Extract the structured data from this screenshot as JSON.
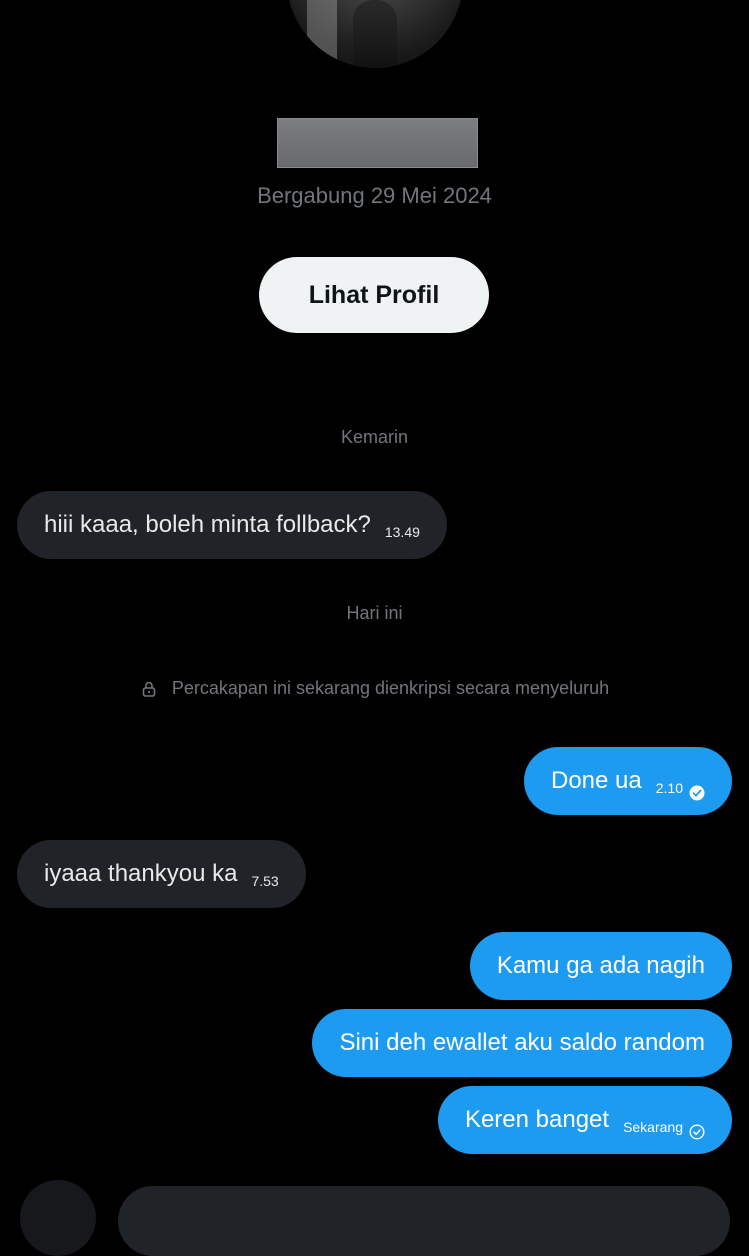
{
  "profile": {
    "joined_text": "Bergabung 29 Mei 2024",
    "view_profile_label": "Lihat Profil"
  },
  "separators": {
    "yesterday": "Kemarin",
    "today": "Hari ini"
  },
  "encryption_notice": "Percakapan ini sekarang dienkripsi secara menyeluruh",
  "messages": [
    {
      "direction": "incoming",
      "text": "hiii kaaa, boleh minta follback?",
      "time": "13.49"
    },
    {
      "direction": "outgoing",
      "text": "Done ua",
      "time": "2.10",
      "status": "read"
    },
    {
      "direction": "incoming",
      "text": "iyaaa thankyou ka",
      "time": "7.53"
    },
    {
      "direction": "outgoing",
      "text": "Kamu ga ada nagih"
    },
    {
      "direction": "outgoing",
      "text": "Sini deh ewallet aku saldo random"
    },
    {
      "direction": "outgoing",
      "text": "Keren banget",
      "time": "Sekarang",
      "status": "sent"
    }
  ],
  "colors": {
    "background": "#000000",
    "incoming_bubble": "#202327",
    "outgoing_bubble": "#1d9bf0",
    "muted_text": "#71767b"
  }
}
